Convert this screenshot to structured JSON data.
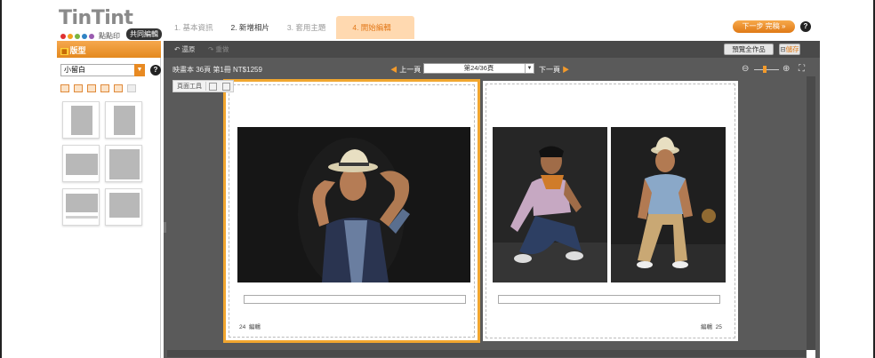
{
  "brand": {
    "logo_text": "TinTint",
    "logo_sub": "點點印",
    "mode_badge": "共同編輯",
    "dot_colors": [
      "#e03030",
      "#f2a11e",
      "#7ab441",
      "#2f83c4",
      "#9a5bb0"
    ]
  },
  "steps": [
    {
      "label": "1. 基本資訊",
      "state": "done"
    },
    {
      "label": "2. 新增相片",
      "state": "current"
    },
    {
      "label": "3. 套用主題",
      "state": "todo"
    },
    {
      "label": "4. 開始編輯",
      "state": "active"
    }
  ],
  "header": {
    "next_label": "下一步 完稿 »",
    "help_icon": "?"
  },
  "sidebar": {
    "title": "版型",
    "select_value": "小留白",
    "help_icon": "?"
  },
  "toolbar": {
    "undo_label": "還原",
    "redo_label": "重做",
    "preview_label": "預覽全作品",
    "save_label": "儲存"
  },
  "book": {
    "info": "映畫本 36頁 第1冊 NT$1259",
    "prev_label": "上一頁",
    "page_select": "第24/36頁",
    "next_label": "下一頁"
  },
  "page_tools": {
    "label": "頁面工具"
  },
  "pages": {
    "left_number": "24",
    "left_tag": "編輯",
    "right_tag": "編輯",
    "right_number": "25"
  },
  "colors": {
    "accent": "#f1a62f",
    "workspace": "#5a5a5a"
  }
}
